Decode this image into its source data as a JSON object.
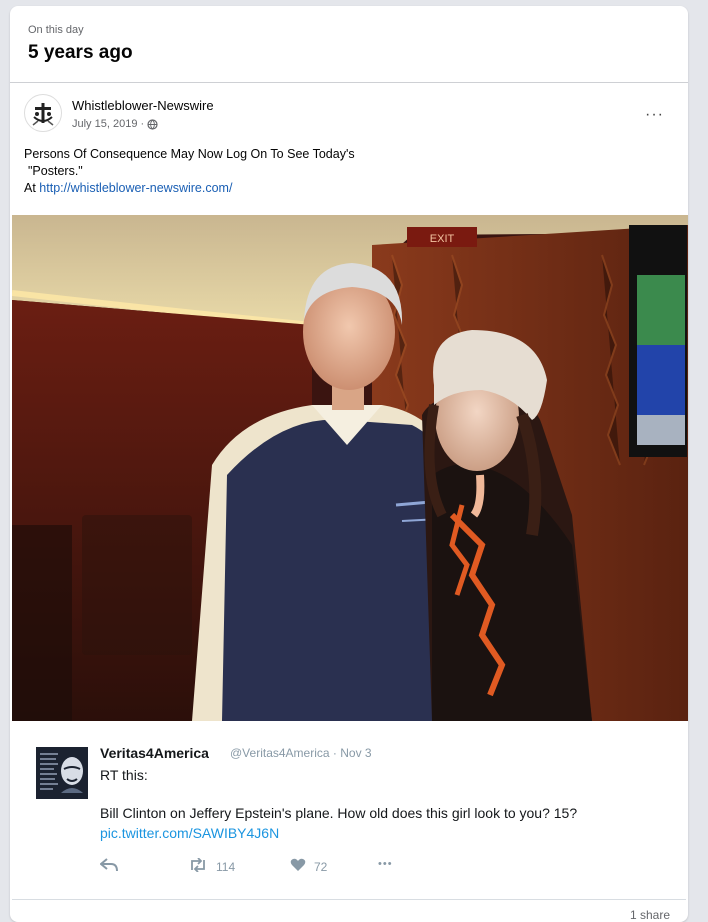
{
  "memory": {
    "label": "On this day",
    "years_ago": "5 years ago"
  },
  "post": {
    "author": "Whistleblower-Newswire",
    "date": "July 15, 2019 ·",
    "more_label": "···",
    "text_line1": "Persons Of Consequence May Now Log On To See Today's",
    "text_line2": "\"Posters.\"",
    "text_line3_prefix": "At ",
    "link": "http://whistleblower-newswire.com/",
    "exit_sign": "EXIT"
  },
  "tweet": {
    "name": "Veritas4America",
    "handle": "@Veritas4America",
    "date": "Nov 3",
    "rt": "RT this:",
    "body": "Bill Clinton on Jeffery Epstein's plane. How old does this girl look to you? 15?",
    "link": "pic.twitter.com/SAWIBY4J6N",
    "retweets": "114",
    "likes": "72",
    "more": "•••"
  },
  "footer": {
    "shares": "1 share"
  },
  "icons": {
    "avatar": "emblem-icon",
    "privacy": "globe-icon",
    "reply": "reply-icon",
    "retweet": "retweet-icon",
    "like": "heart-icon"
  },
  "colors": {
    "link": "#1a5fb4",
    "twitter_link": "#1b95e0",
    "muted": "#65676b"
  }
}
